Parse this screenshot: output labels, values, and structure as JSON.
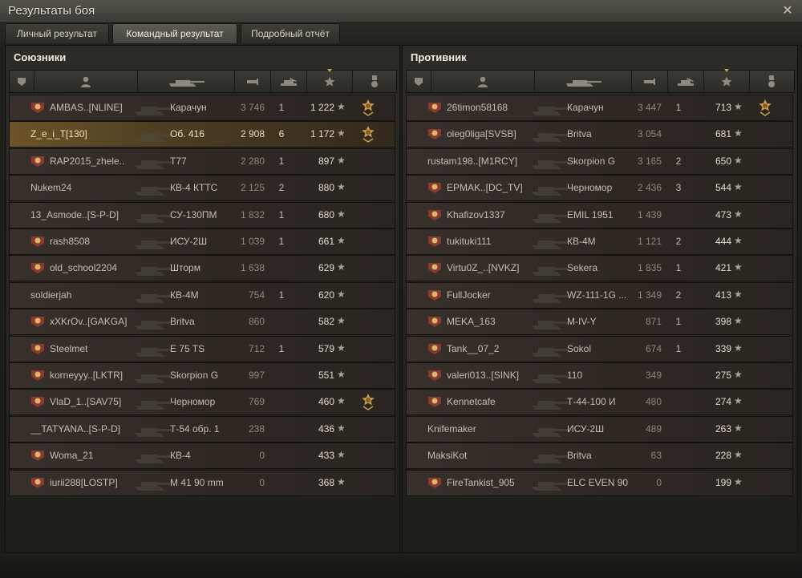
{
  "window": {
    "title": "Результаты боя"
  },
  "tabs": [
    {
      "label": "Личный результат",
      "active": false
    },
    {
      "label": "Командный результат",
      "active": true
    },
    {
      "label": "Подробный отчёт",
      "active": false
    }
  ],
  "allies": {
    "title": "Союзники",
    "rows": [
      {
        "name": "AMBAS..[NLINE]",
        "tank": "Карачун",
        "damage": "3 746",
        "kills": "1",
        "xp": "1 222",
        "icon": "clan-emblem-icon",
        "medal": true,
        "self": false
      },
      {
        "name": "Z_e_i_T[130]",
        "tank": "Об. 416",
        "damage": "2 908",
        "kills": "6",
        "xp": "1 172",
        "icon": "",
        "medal": true,
        "self": true
      },
      {
        "name": "RAP2015_zhele..",
        "tank": "T77",
        "damage": "2 280",
        "kills": "1",
        "xp": "897",
        "icon": "clan-emblem-icon",
        "medal": false,
        "self": false
      },
      {
        "name": "Nukem24",
        "tank": "КВ-4 КТТС",
        "damage": "2 125",
        "kills": "2",
        "xp": "880",
        "icon": "",
        "medal": false,
        "self": false
      },
      {
        "name": "13_Asmode..[S-P-D]",
        "tank": "СУ-130ПМ",
        "damage": "1 832",
        "kills": "1",
        "xp": "680",
        "icon": "",
        "medal": false,
        "self": false
      },
      {
        "name": "rash8508",
        "tank": "ИСУ-2Ш",
        "damage": "1 039",
        "kills": "1",
        "xp": "661",
        "icon": "clan-emblem-icon",
        "medal": false,
        "self": false
      },
      {
        "name": "old_school2204",
        "tank": "Шторм",
        "damage": "1 638",
        "kills": "",
        "xp": "629",
        "icon": "clan-emblem-icon",
        "medal": false,
        "self": false
      },
      {
        "name": "soldierjah",
        "tank": "КВ-4М",
        "damage": "754",
        "kills": "1",
        "xp": "620",
        "icon": "",
        "medal": false,
        "self": false
      },
      {
        "name": "xXKrOv..[GAKGA]",
        "tank": "Britva",
        "damage": "860",
        "kills": "",
        "xp": "582",
        "icon": "clan-emblem-icon",
        "medal": false,
        "self": false
      },
      {
        "name": "Steelmet",
        "tank": "E 75 TS",
        "damage": "712",
        "kills": "1",
        "xp": "579",
        "icon": "clan-emblem-icon",
        "medal": false,
        "self": false
      },
      {
        "name": "korneyyy..[LKTR]",
        "tank": "Skorpion G",
        "damage": "997",
        "kills": "",
        "xp": "551",
        "icon": "clan-emblem-icon",
        "medal": false,
        "self": false
      },
      {
        "name": "VlaD_1..[SAV75]",
        "tank": "Черномор",
        "damage": "769",
        "kills": "",
        "xp": "460",
        "icon": "clan-emblem-icon",
        "medal": true,
        "self": false
      },
      {
        "name": "__TATYANA..[S-P-D]",
        "tank": "Т-54 обр. 1",
        "damage": "238",
        "kills": "",
        "xp": "436",
        "icon": "",
        "medal": false,
        "self": false
      },
      {
        "name": "Woma_21",
        "tank": "КВ-4",
        "damage": "0",
        "kills": "",
        "xp": "433",
        "icon": "clan-emblem-icon",
        "medal": false,
        "self": false
      },
      {
        "name": "iurii288[LOSTP]",
        "tank": "M 41 90 mm",
        "damage": "0",
        "kills": "",
        "xp": "368",
        "icon": "clan-emblem-icon",
        "medal": false,
        "self": false
      }
    ]
  },
  "enemies": {
    "title": "Противник",
    "rows": [
      {
        "name": "26timon58168",
        "tank": "Карачун",
        "damage": "3 447",
        "kills": "1",
        "xp": "713",
        "icon": "clan-emblem-icon",
        "medal": true,
        "self": false
      },
      {
        "name": "oleg0liga[SVSB]",
        "tank": "Britva",
        "damage": "3 054",
        "kills": "",
        "xp": "681",
        "icon": "clan-emblem-icon",
        "medal": false,
        "self": false
      },
      {
        "name": "rustam198..[M1RCY]",
        "tank": "Skorpion G",
        "damage": "3 165",
        "kills": "2",
        "xp": "650",
        "icon": "",
        "medal": false,
        "self": false
      },
      {
        "name": "EPMAK..[DC_TV]",
        "tank": "Черномор",
        "damage": "2 436",
        "kills": "3",
        "xp": "544",
        "icon": "clan-emblem-icon",
        "medal": false,
        "self": false
      },
      {
        "name": "Khafizov1337",
        "tank": "EMIL 1951",
        "damage": "1 439",
        "kills": "",
        "xp": "473",
        "icon": "clan-emblem-icon",
        "medal": false,
        "self": false
      },
      {
        "name": "tukituki111",
        "tank": "КВ-4М",
        "damage": "1 121",
        "kills": "2",
        "xp": "444",
        "icon": "clan-emblem-icon",
        "medal": false,
        "self": false
      },
      {
        "name": "Virtu0Z_..[NVKZ]",
        "tank": "Sekera",
        "damage": "1 835",
        "kills": "1",
        "xp": "421",
        "icon": "clan-emblem-icon",
        "medal": false,
        "self": false
      },
      {
        "name": "FullJocker",
        "tank": "WZ-111-1G ...",
        "damage": "1 349",
        "kills": "2",
        "xp": "413",
        "icon": "clan-emblem-icon",
        "medal": false,
        "self": false
      },
      {
        "name": "MEKA_163",
        "tank": "M-IV-Y",
        "damage": "871",
        "kills": "1",
        "xp": "398",
        "icon": "clan-emblem-icon",
        "medal": false,
        "self": false
      },
      {
        "name": "Tank__07_2",
        "tank": "Sokol",
        "damage": "674",
        "kills": "1",
        "xp": "339",
        "icon": "clan-emblem-icon",
        "medal": false,
        "self": false
      },
      {
        "name": "valeri013..[SINK]",
        "tank": "110",
        "damage": "349",
        "kills": "",
        "xp": "275",
        "icon": "clan-emblem-icon",
        "medal": false,
        "self": false
      },
      {
        "name": "Kennetcafe",
        "tank": "Т-44-100 И",
        "damage": "480",
        "kills": "",
        "xp": "274",
        "icon": "clan-emblem-icon",
        "medal": false,
        "self": false
      },
      {
        "name": "Knifemaker",
        "tank": "ИСУ-2Ш",
        "damage": "489",
        "kills": "",
        "xp": "263",
        "icon": "",
        "medal": false,
        "self": false
      },
      {
        "name": "MaksiKot",
        "tank": "Britva",
        "damage": "63",
        "kills": "",
        "xp": "228",
        "icon": "",
        "medal": false,
        "self": false
      },
      {
        "name": "FireTankist_905",
        "tank": "ELC EVEN 90",
        "damage": "0",
        "kills": "",
        "xp": "199",
        "icon": "clan-emblem-icon",
        "medal": false,
        "self": false
      }
    ]
  },
  "colors": {
    "self_row": "#6b5428",
    "row": "#38302b",
    "medal": "#c9a24a",
    "clan_red": "#b8302a"
  },
  "icons": {
    "header": [
      "squad-icon",
      "player-icon",
      "tank-icon",
      "damage-icon",
      "kills-icon",
      "experience-star-icon",
      "medal-icon"
    ],
    "row_star": "★",
    "close": "✕"
  }
}
